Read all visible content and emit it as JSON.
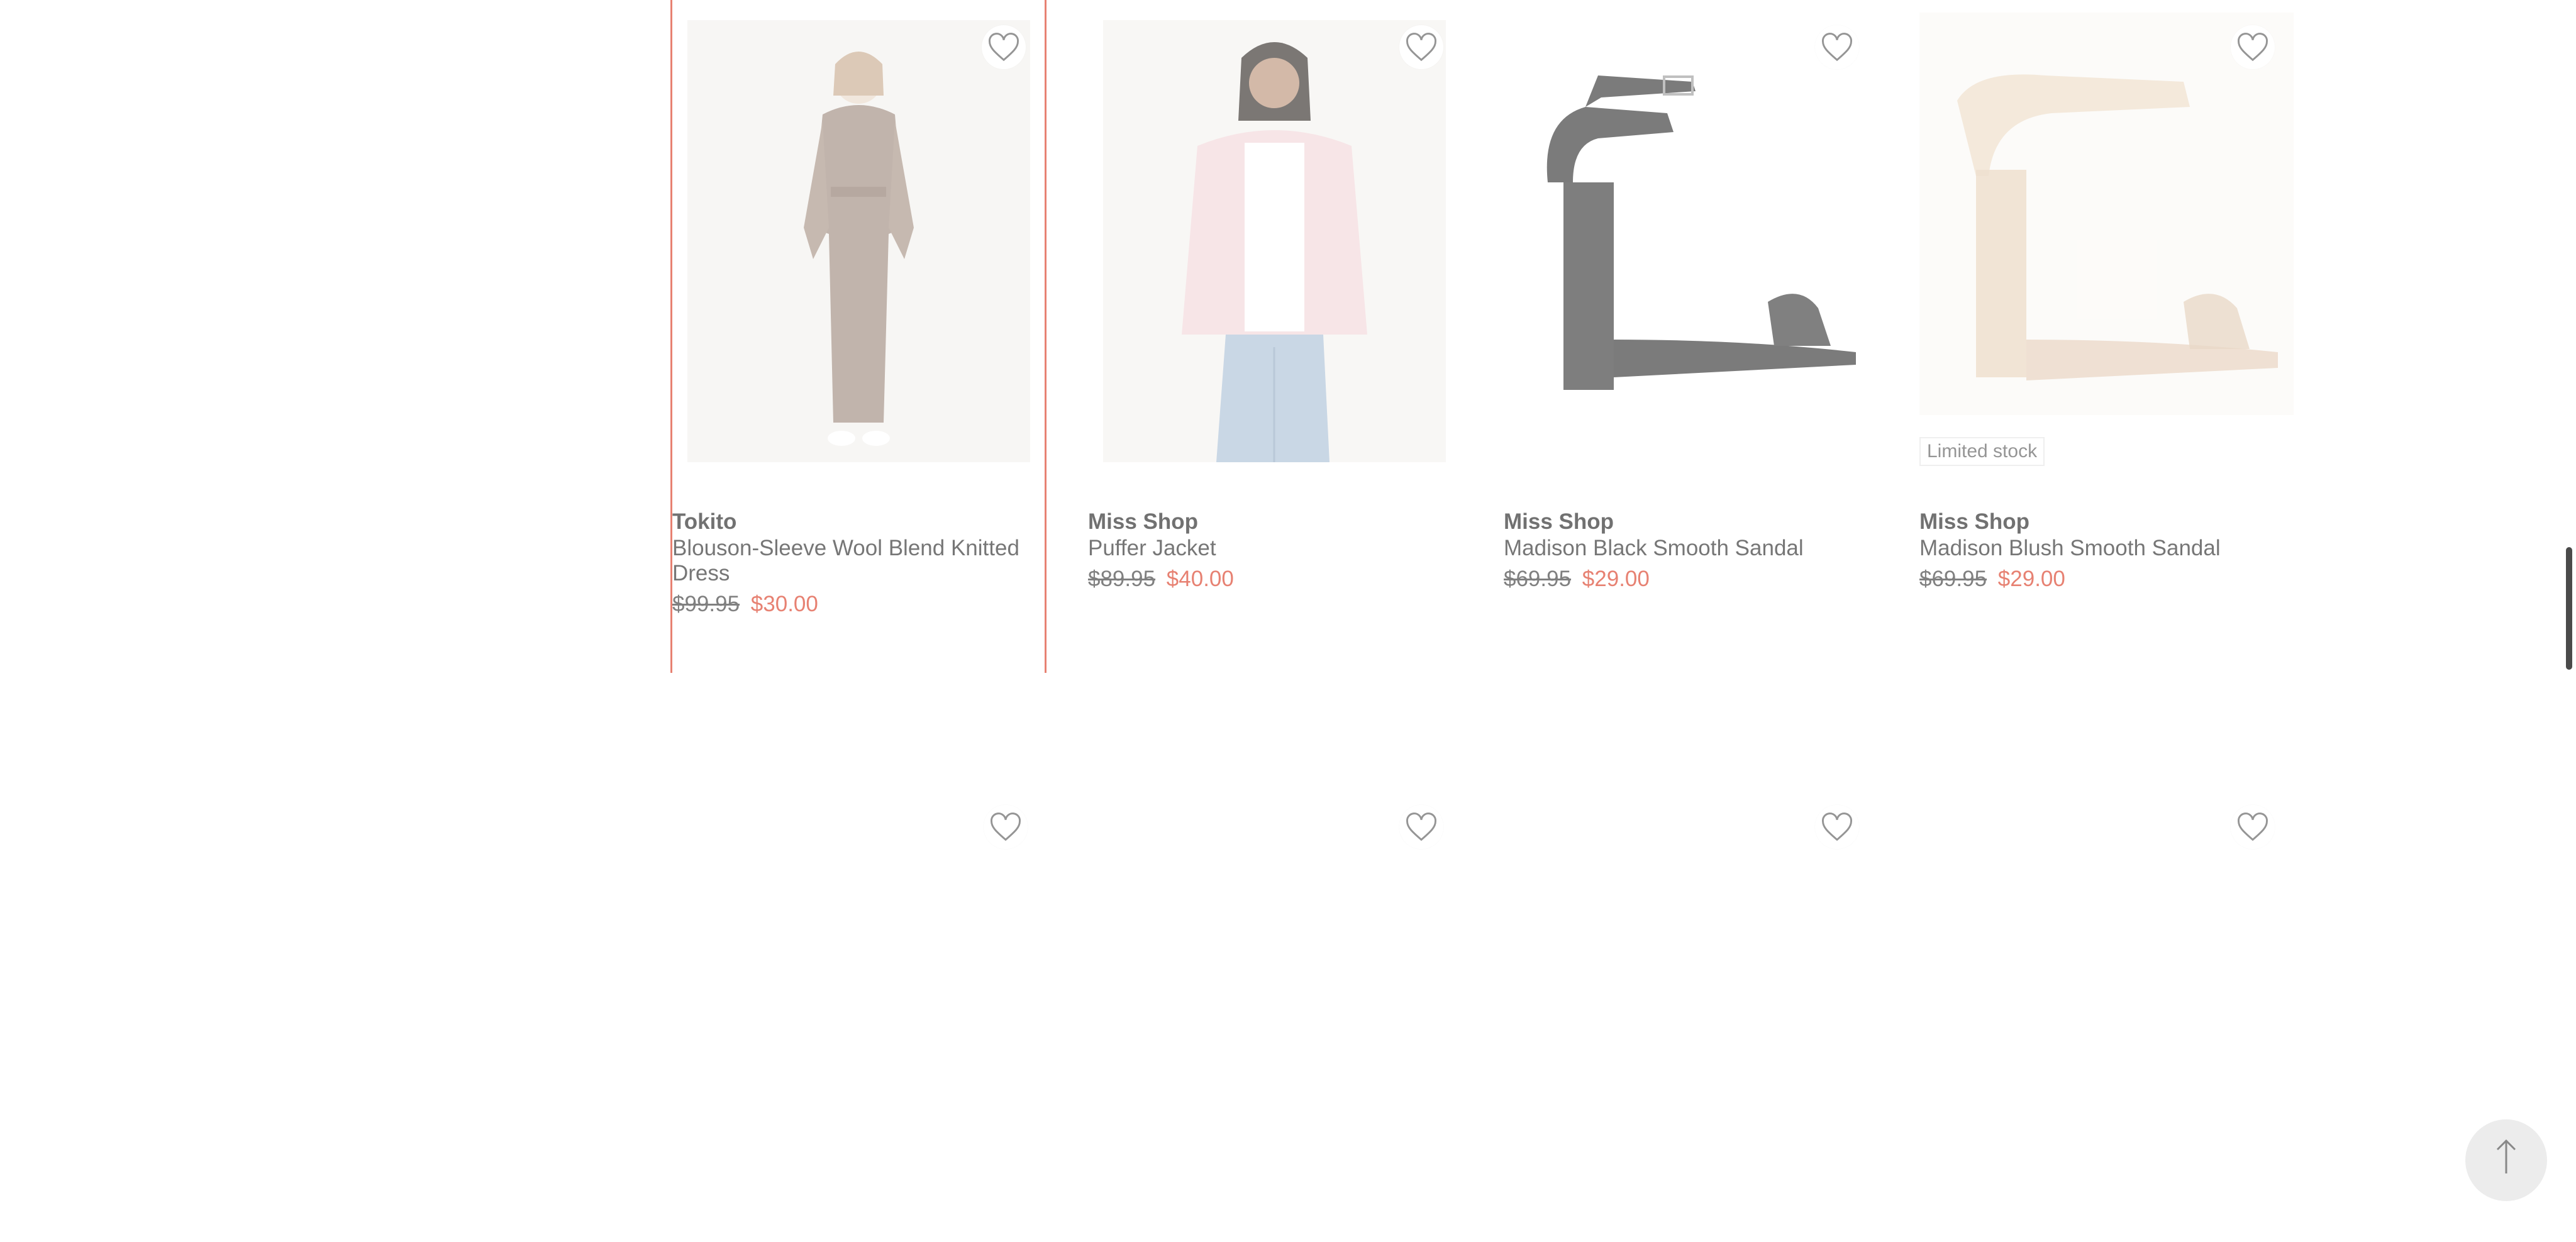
{
  "products": [
    {
      "brand": "Tokito",
      "name": "Blouson-Sleeve Wool Blend Knitted Dress",
      "was_price": "$99.95",
      "now_price": "$30.00",
      "selected": true,
      "image": "model-in-taupe-knit-dress"
    },
    {
      "brand": "Miss Shop",
      "name": "Puffer Jacket",
      "was_price": "$89.95",
      "now_price": "$40.00",
      "image": "model-in-pink-puffer-jacket"
    },
    {
      "brand": "Miss Shop",
      "name": "Madison Black Smooth Sandal",
      "was_price": "$69.95",
      "now_price": "$29.00",
      "image": "black-block-heel-sandal"
    },
    {
      "brand": "Miss Shop",
      "name": "Madison Blush Smooth Sandal",
      "was_price": "$69.95",
      "now_price": "$29.00",
      "badge": "Limited stock",
      "image": "blush-block-heel-sandal"
    }
  ],
  "icons": {
    "wishlist": "heart-outline-icon",
    "back_to_top": "arrow-up-icon"
  },
  "colors": {
    "sale_price": "#d8351c",
    "selected_outline": "#d8351c"
  }
}
